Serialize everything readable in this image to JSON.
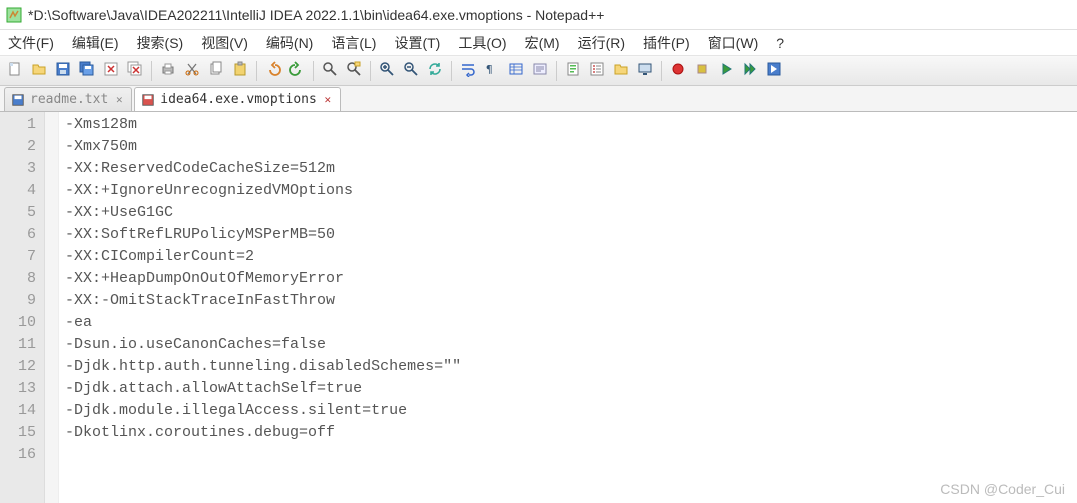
{
  "window": {
    "title": "*D:\\Software\\Java\\IDEA202211\\IntelliJ IDEA 2022.1.1\\bin\\idea64.exe.vmoptions - Notepad++"
  },
  "menu": {
    "items": [
      "文件(F)",
      "编辑(E)",
      "搜索(S)",
      "视图(V)",
      "编码(N)",
      "语言(L)",
      "设置(T)",
      "工具(O)",
      "宏(M)",
      "运行(R)",
      "插件(P)",
      "窗口(W)",
      "?"
    ]
  },
  "toolbar": {
    "icons": [
      "new-file",
      "open-file",
      "save",
      "save-all",
      "close",
      "close-all",
      "print",
      "cut",
      "copy",
      "paste",
      "undo",
      "redo",
      "find",
      "replace",
      "zoom-in",
      "zoom-out",
      "sync",
      "word-wrap",
      "show-all-chars",
      "indent-guide",
      "lang",
      "doc-map",
      "func-list",
      "folder",
      "monitor",
      "record-macro",
      "stop-macro",
      "play-macro",
      "fast-macro",
      "save-macro"
    ]
  },
  "tabs": [
    {
      "label": "readme.txt",
      "active": false,
      "saved": true
    },
    {
      "label": "idea64.exe.vmoptions",
      "active": true,
      "saved": false
    }
  ],
  "editor": {
    "lines": [
      "-Xms128m",
      "-Xmx750m",
      "-XX:ReservedCodeCacheSize=512m",
      "-XX:+IgnoreUnrecognizedVMOptions",
      "-XX:+UseG1GC",
      "-XX:SoftRefLRUPolicyMSPerMB=50",
      "-XX:CICompilerCount=2",
      "-XX:+HeapDumpOnOutOfMemoryError",
      "-XX:-OmitStackTraceInFastThrow",
      "-ea",
      "-Dsun.io.useCanonCaches=false",
      "-Djdk.http.auth.tunneling.disabledSchemes=\"\"",
      "-Djdk.attach.allowAttachSelf=true",
      "-Djdk.module.illegalAccess.silent=true",
      "-Dkotlinx.coroutines.debug=off",
      ""
    ]
  },
  "watermark": "CSDN @Coder_Cui"
}
